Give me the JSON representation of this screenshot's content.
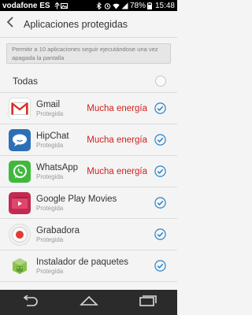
{
  "status": {
    "carrier": "vodafone ES",
    "battery": "78%",
    "time": "15:48"
  },
  "header": {
    "title": "Aplicaciones protegidas"
  },
  "notice": "Permitir a 10 aplicaciones seguir ejecutándose una vez apagada la pantalla",
  "select_all": {
    "label": "Todas",
    "checked": false
  },
  "apps": [
    {
      "name": "Gmail",
      "status": "Protegida",
      "warning": "Mucha energía",
      "checked": true,
      "icon": "gmail-icon"
    },
    {
      "name": "HipChat",
      "status": "Protegida",
      "warning": "Mucha energía",
      "checked": true,
      "icon": "hipchat-icon"
    },
    {
      "name": "WhatsApp",
      "status": "Protegida",
      "warning": "Mucha energía",
      "checked": true,
      "icon": "whatsapp-icon"
    },
    {
      "name": "Google Play Movies",
      "status": "Protegida",
      "checked": true,
      "icon": "play-movies-icon"
    },
    {
      "name": "Grabadora",
      "status": "Protegida",
      "checked": true,
      "icon": "recorder-icon"
    },
    {
      "name": "Instalador de paquetes",
      "status": "Protegida",
      "checked": true,
      "icon": "package-installer-icon"
    }
  ],
  "colors": {
    "warning": "#d11f1f",
    "check": "#2a84c7"
  }
}
